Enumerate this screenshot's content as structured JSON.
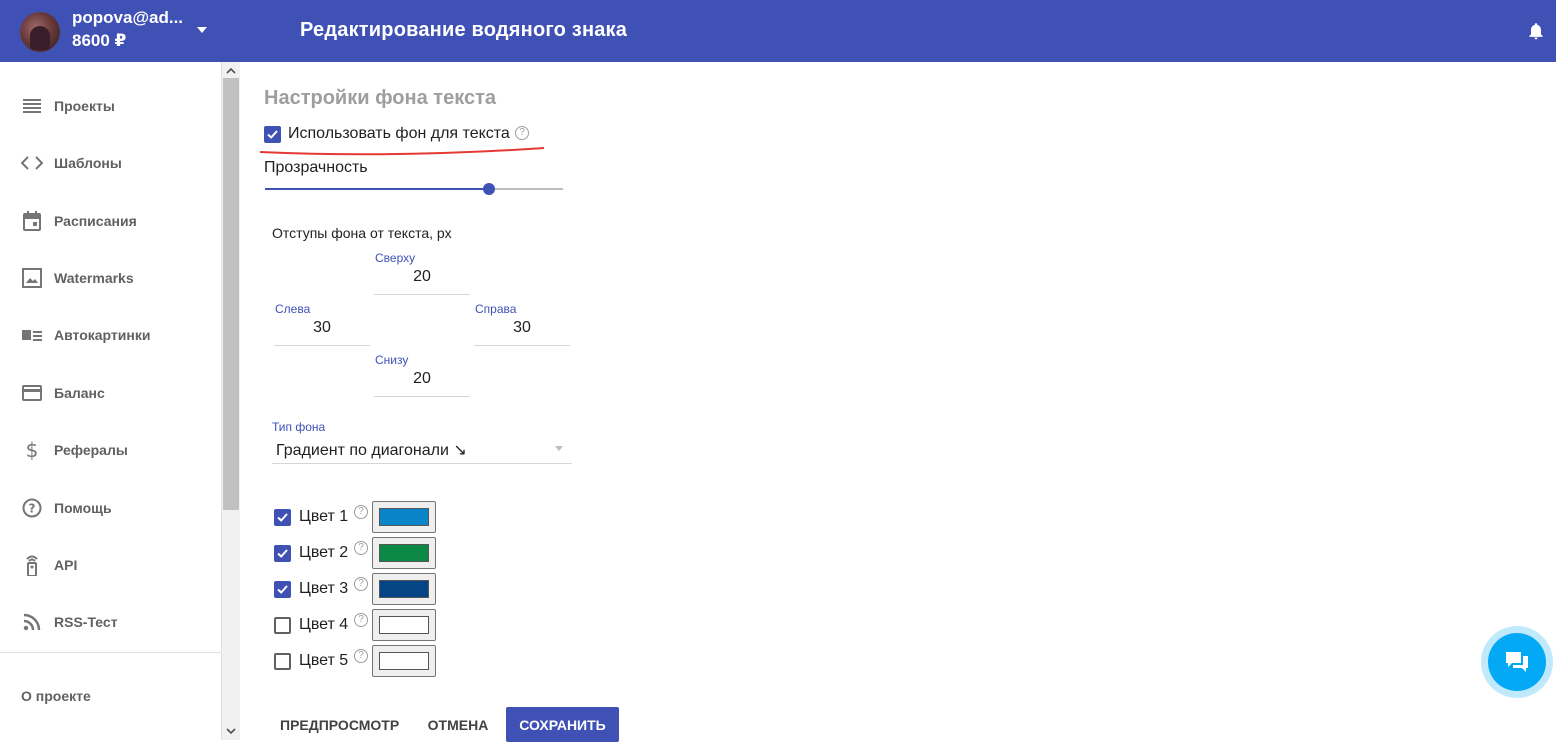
{
  "header": {
    "user_email": "popova@ad...",
    "balance": "8600 ₽",
    "page_title": "Редактирование водяного знака"
  },
  "sidebar": {
    "items": [
      {
        "label": "Проекты",
        "icon": "list-icon"
      },
      {
        "label": "Шаблоны",
        "icon": "code-icon"
      },
      {
        "label": "Расписания",
        "icon": "calendar-icon"
      },
      {
        "label": "Watermarks",
        "icon": "image-frame-icon"
      },
      {
        "label": "Автокартинки",
        "icon": "image-text-icon"
      },
      {
        "label": "Баланс",
        "icon": "credit-card-icon"
      },
      {
        "label": "Рефералы",
        "icon": "dollar-icon"
      },
      {
        "label": "Помощь",
        "icon": "help-icon"
      },
      {
        "label": "API",
        "icon": "remote-icon"
      },
      {
        "label": "RSS-Тест",
        "icon": "rss-icon"
      }
    ],
    "about": "О проекте"
  },
  "form": {
    "section_title": "Настройки фона текста",
    "use_background": {
      "label": "Использовать фон для текста",
      "checked": true
    },
    "opacity": {
      "label": "Прозрачность",
      "value": 0.75
    },
    "padding": {
      "title": "Отступы фона от текста, px",
      "top": {
        "label": "Сверху",
        "value": "20"
      },
      "left": {
        "label": "Слева",
        "value": "30"
      },
      "right": {
        "label": "Справа",
        "value": "30"
      },
      "bottom": {
        "label": "Снизу",
        "value": "20"
      }
    },
    "background_type": {
      "label": "Тип фона",
      "value": "Градиент по диагонали ↘"
    },
    "colors": [
      {
        "label": "Цвет 1",
        "checked": true,
        "color": "#0a84c8"
      },
      {
        "label": "Цвет 2",
        "checked": true,
        "color": "#0c8a45"
      },
      {
        "label": "Цвет 3",
        "checked": true,
        "color": "#054586"
      },
      {
        "label": "Цвет 4",
        "checked": false,
        "color": "#ffffff"
      },
      {
        "label": "Цвет 5",
        "checked": false,
        "color": "#ffffff"
      }
    ]
  },
  "actions": {
    "preview": "ПРЕДПРОСМОТР",
    "cancel": "ОТМЕНА",
    "save": "СОХРАНИТЬ"
  },
  "theme": {
    "primary": "#3f51b5",
    "chat_accent": "#03a9f4"
  }
}
